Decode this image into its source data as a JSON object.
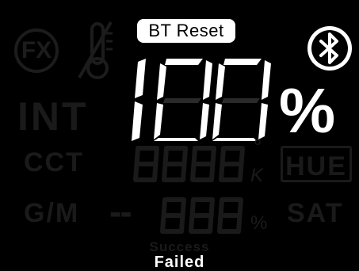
{
  "bt_reset_label": "BT Reset",
  "fx_label": "FX",
  "int_label": "INT",
  "cct_label": "CCT",
  "gm_label": "G/M",
  "hue_label": "HUE",
  "sat_label": "SAT",
  "brightness_value": "100",
  "brightness_unit": "%",
  "cct_value": "8888",
  "cct_degree": "°",
  "cct_unit": "K",
  "gm_sign": "--",
  "gm_value": "888",
  "gm_unit": "%",
  "status_success": "Success",
  "status_failed": "Failed",
  "icons": {
    "bluetooth": "bluetooth-icon",
    "thermometer": "thermometer-icon",
    "fx": "fx-icon"
  },
  "colors": {
    "active": "#ffffff",
    "inactive": "#1a1a1a",
    "background": "#000000"
  }
}
